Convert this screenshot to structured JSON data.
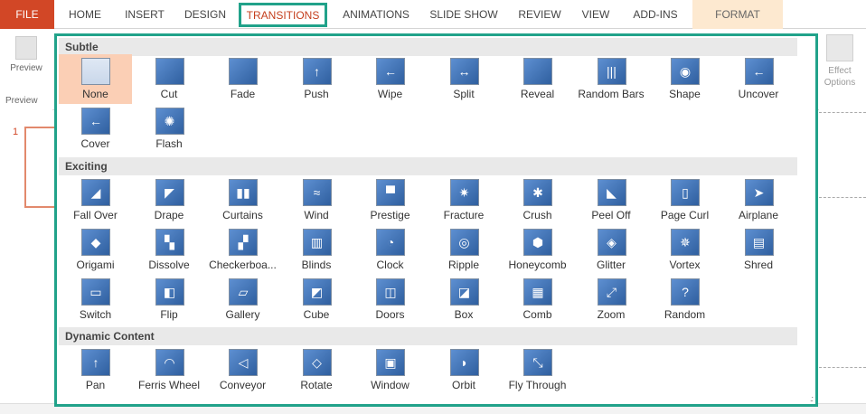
{
  "ribbon": {
    "tabs": [
      {
        "label": "FILE"
      },
      {
        "label": "HOME"
      },
      {
        "label": "INSERT"
      },
      {
        "label": "DESIGN"
      },
      {
        "label": "TRANSITIONS"
      },
      {
        "label": "ANIMATIONS"
      },
      {
        "label": "SLIDE SHOW"
      },
      {
        "label": "REVIEW"
      },
      {
        "label": "VIEW"
      },
      {
        "label": "ADD-INS"
      },
      {
        "label": "FORMAT"
      }
    ],
    "active_tab": "TRANSITIONS",
    "preview_label": "Preview",
    "preview_group_label": "Preview",
    "effect_options_label": "Effect Options"
  },
  "slide_panel": {
    "slide_number": "1"
  },
  "gallery": {
    "sections": [
      {
        "title": "Subtle",
        "items": [
          {
            "label": "None",
            "icon": "none-icon",
            "selected": true
          },
          {
            "label": "Cut",
            "icon": "cut-icon"
          },
          {
            "label": "Fade",
            "icon": "fade-icon"
          },
          {
            "label": "Push",
            "icon": "push-icon"
          },
          {
            "label": "Wipe",
            "icon": "wipe-icon"
          },
          {
            "label": "Split",
            "icon": "split-icon"
          },
          {
            "label": "Reveal",
            "icon": "reveal-icon"
          },
          {
            "label": "Random Bars",
            "icon": "random-bars-icon"
          },
          {
            "label": "Shape",
            "icon": "shape-icon"
          },
          {
            "label": "Uncover",
            "icon": "uncover-icon"
          },
          {
            "label": "Cover",
            "icon": "cover-icon"
          },
          {
            "label": "Flash",
            "icon": "flash-icon"
          }
        ]
      },
      {
        "title": "Exciting",
        "items": [
          {
            "label": "Fall Over",
            "icon": "fall-over-icon"
          },
          {
            "label": "Drape",
            "icon": "drape-icon"
          },
          {
            "label": "Curtains",
            "icon": "curtains-icon"
          },
          {
            "label": "Wind",
            "icon": "wind-icon"
          },
          {
            "label": "Prestige",
            "icon": "prestige-icon"
          },
          {
            "label": "Fracture",
            "icon": "fracture-icon"
          },
          {
            "label": "Crush",
            "icon": "crush-icon"
          },
          {
            "label": "Peel Off",
            "icon": "peel-off-icon"
          },
          {
            "label": "Page Curl",
            "icon": "page-curl-icon"
          },
          {
            "label": "Airplane",
            "icon": "airplane-icon"
          },
          {
            "label": "Origami",
            "icon": "origami-icon"
          },
          {
            "label": "Dissolve",
            "icon": "dissolve-icon"
          },
          {
            "label": "Checkerboa...",
            "icon": "checkerboard-icon"
          },
          {
            "label": "Blinds",
            "icon": "blinds-icon"
          },
          {
            "label": "Clock",
            "icon": "clock-icon"
          },
          {
            "label": "Ripple",
            "icon": "ripple-icon"
          },
          {
            "label": "Honeycomb",
            "icon": "honeycomb-icon"
          },
          {
            "label": "Glitter",
            "icon": "glitter-icon"
          },
          {
            "label": "Vortex",
            "icon": "vortex-icon"
          },
          {
            "label": "Shred",
            "icon": "shred-icon"
          },
          {
            "label": "Switch",
            "icon": "switch-icon"
          },
          {
            "label": "Flip",
            "icon": "flip-icon"
          },
          {
            "label": "Gallery",
            "icon": "gallery-icon"
          },
          {
            "label": "Cube",
            "icon": "cube-icon"
          },
          {
            "label": "Doors",
            "icon": "doors-icon"
          },
          {
            "label": "Box",
            "icon": "box-icon"
          },
          {
            "label": "Comb",
            "icon": "comb-icon"
          },
          {
            "label": "Zoom",
            "icon": "zoom-icon"
          },
          {
            "label": "Random",
            "icon": "random-icon"
          }
        ]
      },
      {
        "title": "Dynamic Content",
        "items": [
          {
            "label": "Pan",
            "icon": "pan-icon"
          },
          {
            "label": "Ferris Wheel",
            "icon": "ferris-wheel-icon"
          },
          {
            "label": "Conveyor",
            "icon": "conveyor-icon"
          },
          {
            "label": "Rotate",
            "icon": "rotate-icon"
          },
          {
            "label": "Window",
            "icon": "window-icon"
          },
          {
            "label": "Orbit",
            "icon": "orbit-icon"
          },
          {
            "label": "Fly Through",
            "icon": "fly-through-icon"
          }
        ]
      }
    ]
  },
  "colors": {
    "accent": "#21a28a",
    "file_tab": "#d24726",
    "active_tab_text": "#c43e1c",
    "selected_item": "#fbcfb5",
    "icon_blue": "#3c6eb4"
  }
}
